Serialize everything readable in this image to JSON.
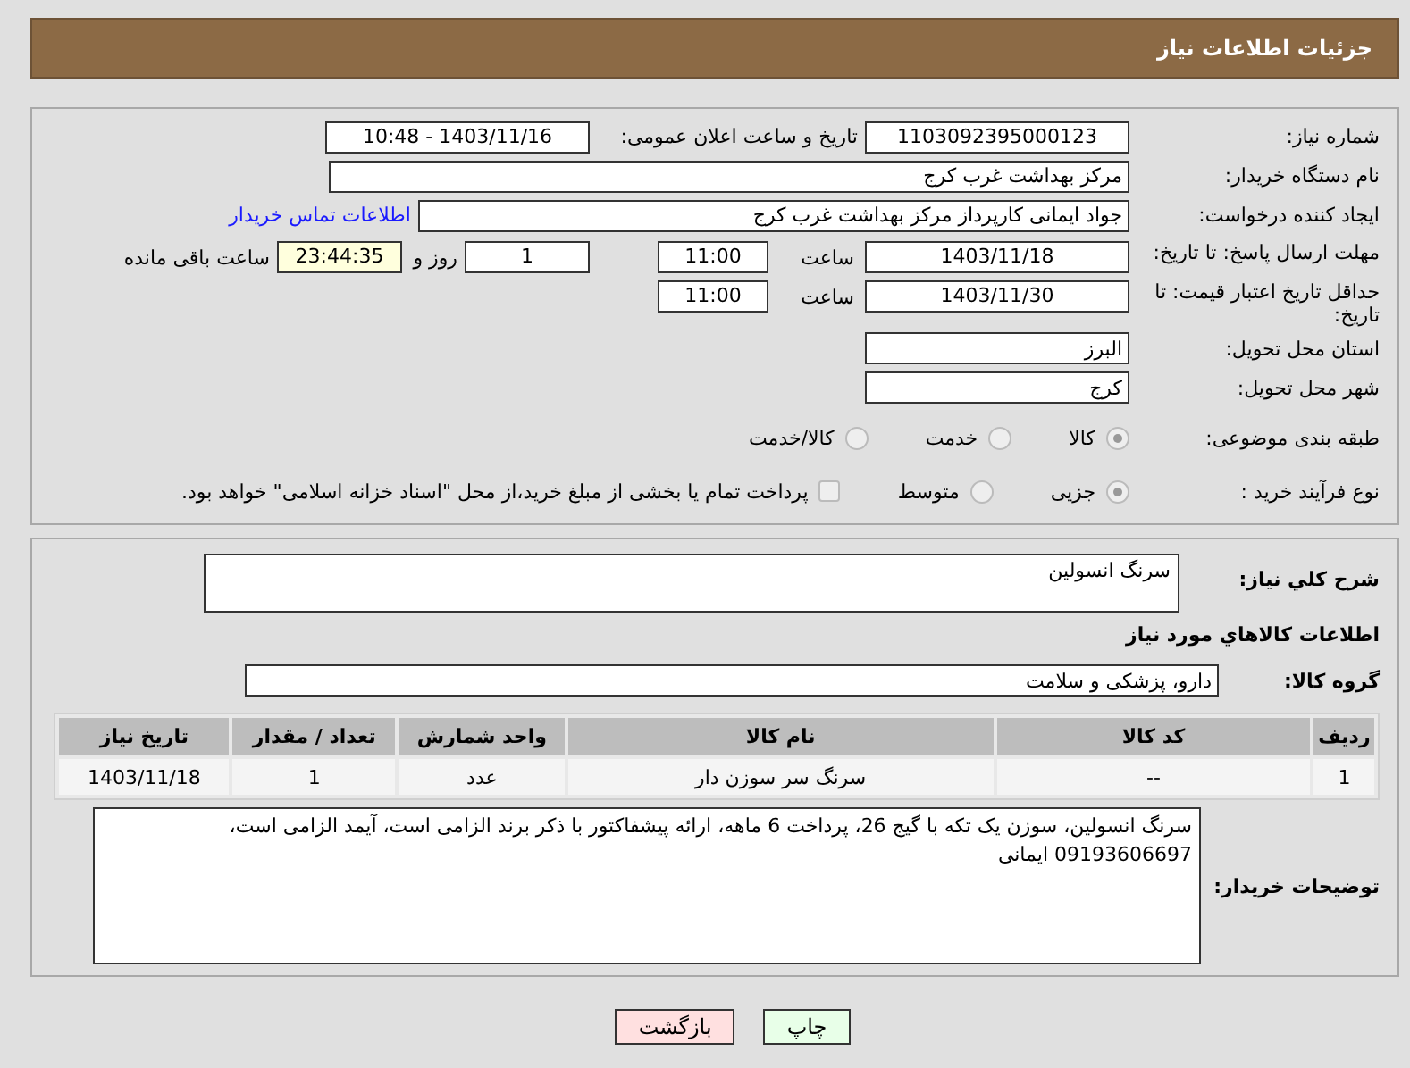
{
  "header": {
    "title": "جزئیات اطلاعات نیاز"
  },
  "need_number": {
    "label": "شماره نیاز:",
    "value": "1103092395000123"
  },
  "announce_datetime": {
    "label": "تاریخ و ساعت اعلان عمومی:",
    "value": "1403/11/16 - 10:48"
  },
  "buyer_org": {
    "label": "نام دستگاه خریدار:",
    "value": "مرکز بهداشت غرب کرج"
  },
  "requester": {
    "label": "ایجاد کننده درخواست:",
    "value": "جواد ایمانی کارپرداز مرکز بهداشت غرب کرج",
    "link": "اطلاعات تماس خریدار"
  },
  "reply_deadline": {
    "label": "مهلت ارسال پاسخ: تا تاریخ:",
    "date": "1403/11/18",
    "time_label": "ساعت",
    "time": "11:00",
    "days": "1",
    "days_label": "روز و",
    "remaining": "23:44:35",
    "remaining_label": "ساعت باقی مانده"
  },
  "price_validity": {
    "label": "حداقل تاریخ اعتبار قیمت: تا تاریخ:",
    "date": "1403/11/30",
    "time_label": "ساعت",
    "time": "11:00"
  },
  "province": {
    "label": "استان محل تحویل:",
    "value": "البرز"
  },
  "city": {
    "label": "شهر محل تحویل:",
    "value": "کرج"
  },
  "category": {
    "label": "طبقه بندی موضوعی:",
    "options": [
      {
        "label": "کالا",
        "selected": true
      },
      {
        "label": "خدمت",
        "selected": false
      },
      {
        "label": "کالا/خدمت",
        "selected": false
      }
    ]
  },
  "purchase_process": {
    "label": "نوع فرآیند خرید :",
    "options": [
      {
        "label": "جزیی",
        "selected": true
      },
      {
        "label": "متوسط",
        "selected": false
      }
    ],
    "treasury": {
      "label": "پرداخت تمام یا بخشی از مبلغ خرید،از محل \"اسناد خزانه اسلامی\" خواهد بود.",
      "checked": false
    }
  },
  "description": {
    "label": "شرح کلي نياز:",
    "value": "سرنگ انسولین"
  },
  "goods_title": "اطلاعات کالاهاي مورد نياز",
  "goods_group": {
    "label": "گروه کالا:",
    "value": "دارو، پزشکی و سلامت"
  },
  "table": {
    "columns": [
      "رديف",
      "کد کالا",
      "نام کالا",
      "واحد شمارش",
      "تعداد / مقدار",
      "تاریخ نیاز"
    ],
    "rows": [
      [
        "1",
        "--",
        "سرنگ سر سوزن دار",
        "عدد",
        "1",
        "1403/11/18"
      ]
    ]
  },
  "buyer_notes": {
    "label": "توضیحات خریدار:",
    "value": "سرنگ انسولین، سوزن یک تکه با گیج 26، پرداخت 6 ماهه، ارائه پیشفاکتور با ذکر برند الزامی است، آیمد الزامی است، 09193606697 ایمانی"
  },
  "buttons": [
    {
      "label": "چاپ",
      "kind": "print"
    },
    {
      "label": "بازگشت",
      "kind": "back"
    }
  ]
}
